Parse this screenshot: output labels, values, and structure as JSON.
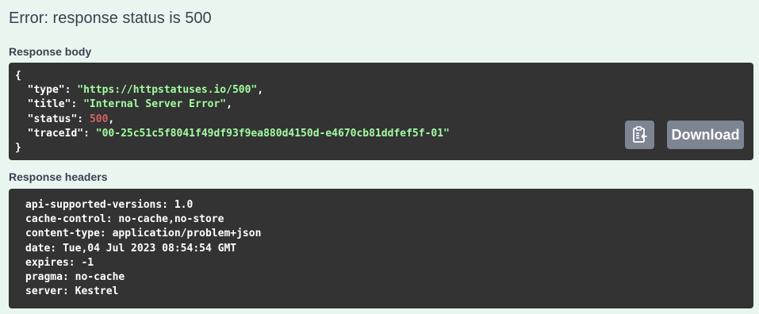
{
  "error": {
    "title": "Error: response status is 500"
  },
  "response_body": {
    "label": "Response body",
    "open_brace": "{",
    "close_brace": "}",
    "fields": [
      {
        "key": "\"type\"",
        "value": "\"https://httpstatuses.io/500\"",
        "kind": "string",
        "trail": ","
      },
      {
        "key": "\"title\"",
        "value": "\"Internal Server Error\"",
        "kind": "string",
        "trail": ","
      },
      {
        "key": "\"status\"",
        "value": "500",
        "kind": "number",
        "trail": ","
      },
      {
        "key": "\"traceId\"",
        "value": "\"00-25c51c5f8041f49df93f9ea880d4150d-e4670cb81ddfef5f-01\"",
        "kind": "string",
        "trail": ""
      }
    ],
    "copy_icon": "clipboard-icon",
    "download_label": "Download"
  },
  "response_headers": {
    "label": "Response headers",
    "lines": [
      "api-supported-versions: 1.0",
      "cache-control: no-cache,no-store",
      "content-type: application/problem+json",
      "date: Tue,04 Jul 2023 08:54:54 GMT",
      "expires: -1",
      "pragma: no-cache",
      "server: Kestrel"
    ]
  },
  "colors": {
    "background": "#e9f6f0",
    "code_background": "#333333",
    "string": "#a2fca2",
    "number": "#d36363",
    "button": "#7d8492",
    "heading_text": "#3b4151"
  }
}
